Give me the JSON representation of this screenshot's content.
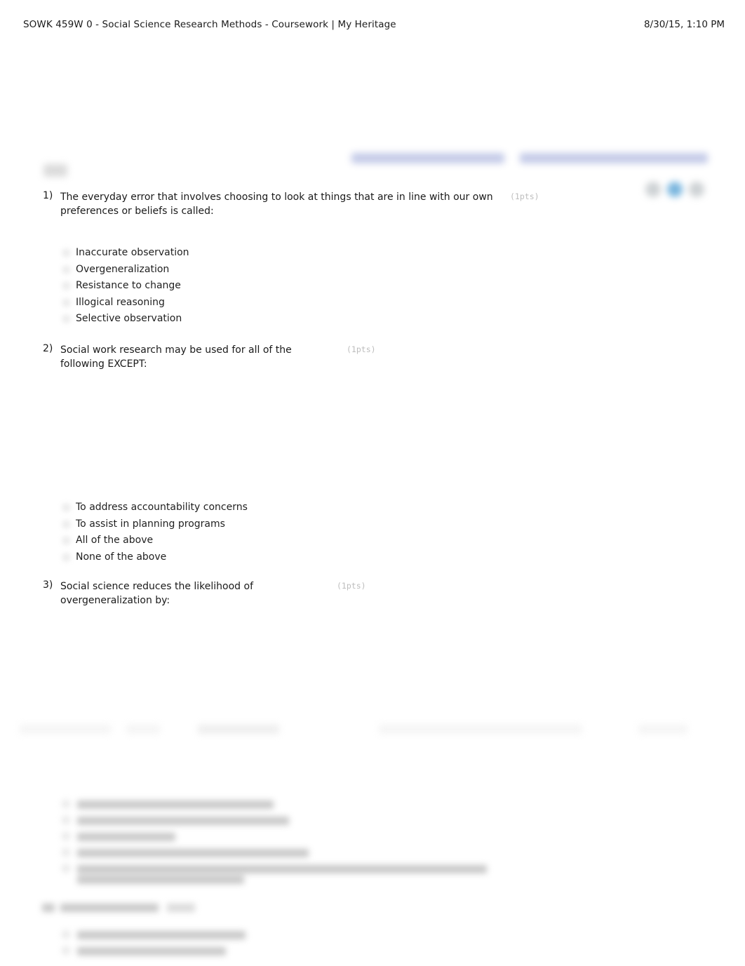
{
  "print_header": {
    "title": "SOWK 459W 0 - Social Science Research Methods - Coursework | My Heritage",
    "date": "8/30/15, 1:10 PM"
  },
  "chrome": {
    "breadcrumb_links": [
      {
        "name": "nav-link-college-arts-sciences",
        "redacted": true
      },
      {
        "name": "nav-link-college-education-psychology",
        "redacted": true
      }
    ],
    "logo": {
      "name": "site-logo",
      "redacted": true
    },
    "toolbar_icons": [
      {
        "name": "toolbar-icon-left",
        "color": "#c4c9cc",
        "redacted": true
      },
      {
        "name": "toolbar-icon-center",
        "color": "#61a8d8",
        "redacted": true
      },
      {
        "name": "toolbar-icon-right",
        "color": "#c4c9cc",
        "redacted": true
      }
    ]
  },
  "quiz": {
    "points_suffix": "(1pts)",
    "questions": [
      {
        "number": "1)",
        "text": "The everyday error that involves choosing to look at things that are in line with our own preferences or beliefs is called:",
        "points": "(1pts)",
        "options": [
          "Inaccurate observation",
          "Overgeneralization",
          "Resistance to change",
          "Illogical reasoning",
          "Selective observation"
        ]
      },
      {
        "number": "2)",
        "text": "Social work research may be used for all of the following EXCEPT:",
        "points": "(1pts)",
        "options": [
          "To address accountability concerns",
          "To assist in planning programs",
          "All of the above",
          "None of the above"
        ]
      },
      {
        "number": "3)",
        "text": "Social science reduces the likelihood of overgeneralization by:",
        "points": "(1pts)",
        "options": []
      }
    ]
  },
  "redacted_regions": {
    "page_break_band": {
      "name": "page-break-band",
      "redacted": true
    },
    "next_question_options": {
      "name": "blurred-option-list",
      "redacted": true
    },
    "next_question_heading": {
      "name": "blurred-question-heading",
      "redacted": true
    },
    "next_question_options_2": {
      "name": "blurred-option-list-2",
      "redacted": true
    }
  }
}
